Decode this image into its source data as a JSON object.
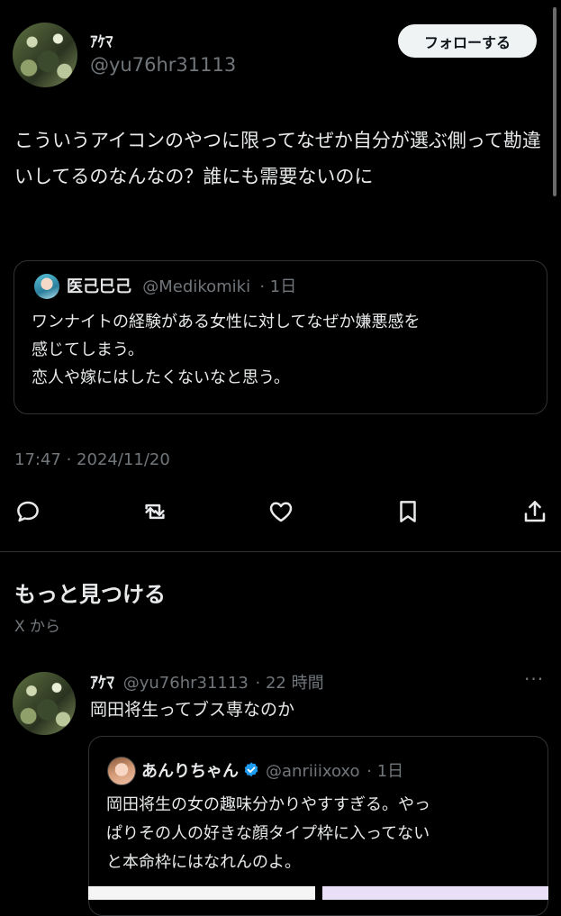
{
  "tweet": {
    "display_name": "ｱｹﾏ",
    "handle": "@yu76hr31113",
    "follow_label": "フォローする",
    "text": "こういうアイコンのやつに限ってなぜか自分が選ぶ側って勘違いしてるのなんなの？誰にも需要ないのに",
    "timestamp": "17:47 · 2024/11/20",
    "quote": {
      "display_name": "医己巳己",
      "handle": "@Medikomiki",
      "age": "· 1日",
      "text_lines": [
        "ワンナイトの経験がある女性に対してなぜか嫌悪感を",
        "感じてしまう。",
        "恋人や嫁にはしたくないなと思う。"
      ]
    }
  },
  "actions": {
    "reply_icon": "reply-icon",
    "retweet_icon": "retweet-icon",
    "like_icon": "heart-icon",
    "bookmark_icon": "bookmark-icon",
    "share_icon": "share-icon"
  },
  "discover": {
    "title": "もっと見つける",
    "subtitle": "X から"
  },
  "tweet2": {
    "display_name": "ｱｹﾏ",
    "handle": "@yu76hr31113",
    "age": "· 22 時間",
    "more": "···",
    "text": "岡田将生ってブス専なのか",
    "quote": {
      "display_name": "あんりちゃん",
      "handle": "@anriiixoxo",
      "age": "· 1日",
      "text_lines": [
        "岡田将生の女の趣味分かりやすすぎる。やっ",
        "ぱりその人の好きな顔タイプ枠に入ってない",
        "と本命枠にはなれんのよ。"
      ]
    }
  },
  "colors": {
    "background": "#000000",
    "text": "#e7e9ea",
    "secondary": "#71767b",
    "verified": "#1d9bf0"
  }
}
